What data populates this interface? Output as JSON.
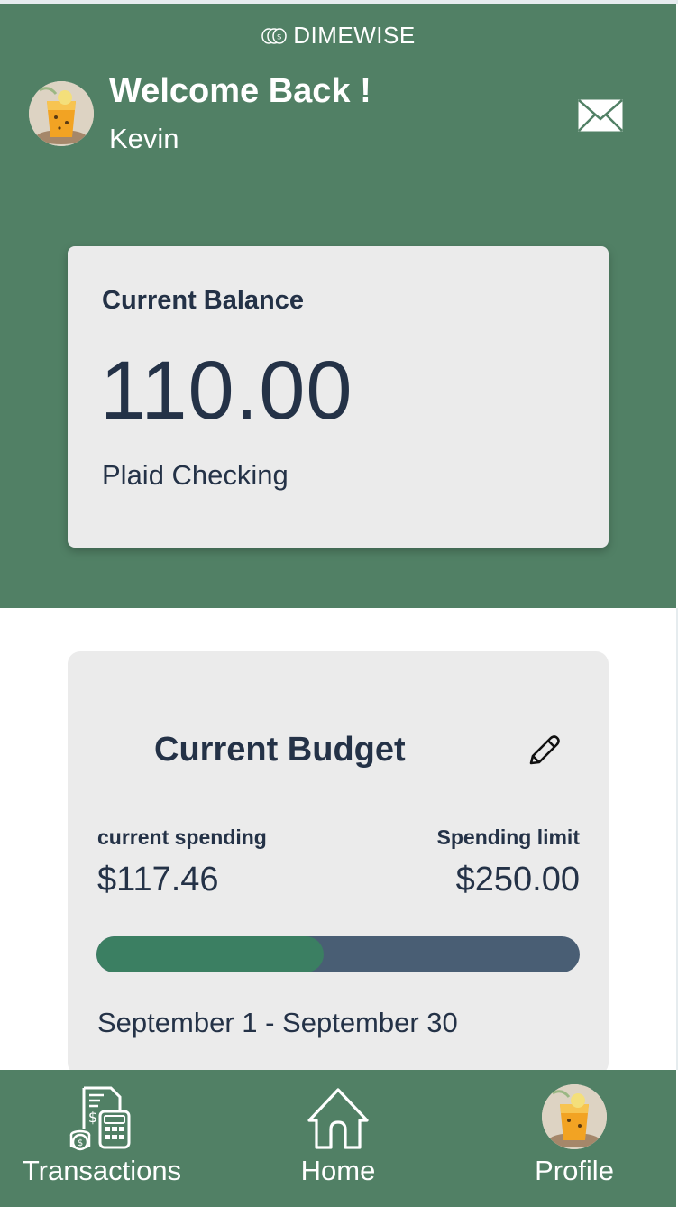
{
  "app": {
    "brand": "DIMEWISE"
  },
  "header": {
    "welcome": "Welcome Back !",
    "username": "Kevin"
  },
  "balance": {
    "label": "Current Balance",
    "value": "110.00",
    "account": "Plaid Checking"
  },
  "budget": {
    "title": "Current Budget",
    "spending_label": "current spending",
    "spending_value": "$117.46",
    "limit_label": "Spending limit",
    "limit_value": "$250.00",
    "progress_fraction": 0.4698,
    "period": "September 1 - September 30"
  },
  "nav": {
    "transactions": "Transactions",
    "home": "Home",
    "profile": "Profile"
  },
  "colors": {
    "header_green": "#518065",
    "card_bg": "#ebebeb",
    "text_navy": "#243247",
    "progress_fill": "#3b7f62",
    "progress_track": "#495e74"
  },
  "icons": {
    "brand": "coins-icon",
    "mail": "envelope-icon",
    "edit": "pencil-icon",
    "transactions": "receipt-calculator-icon",
    "home": "house-icon",
    "profile": "avatar"
  }
}
